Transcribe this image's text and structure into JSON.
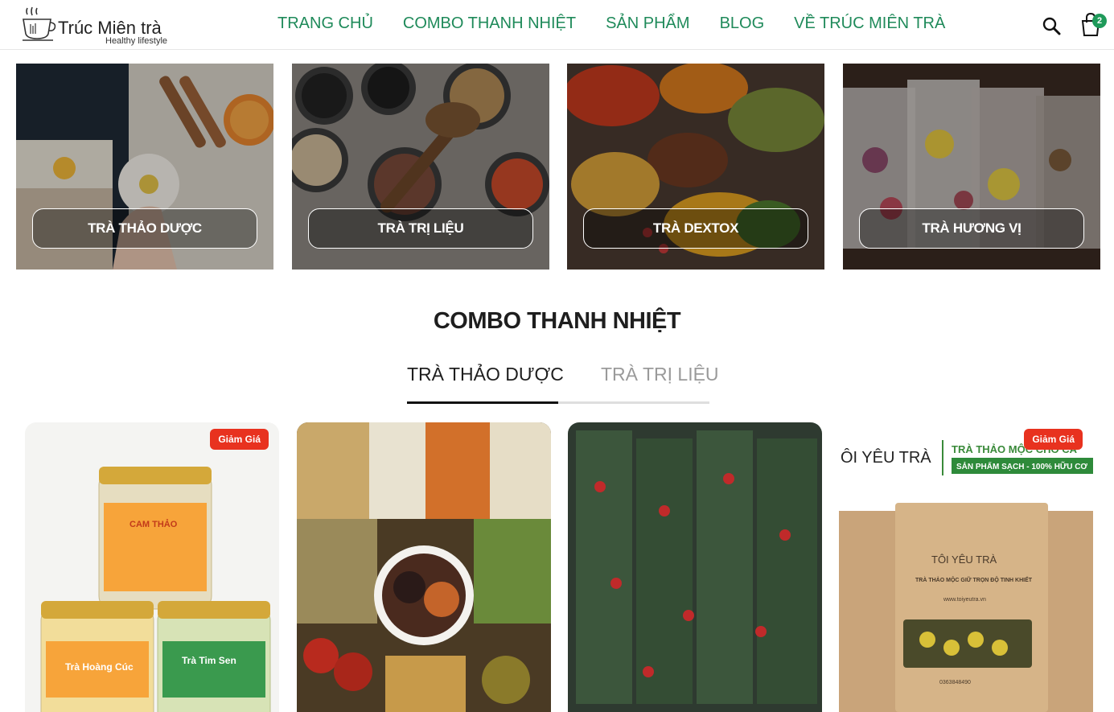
{
  "header": {
    "logo_name": "Trúc Miên trà",
    "logo_tagline": "Healthy lifestyle",
    "nav": [
      "TRANG CHỦ",
      "COMBO THANH NHIỆT",
      "SẢN PHẨM",
      "BLOG",
      "VỀ TRÚC MIÊN TRÀ"
    ],
    "cart_count": "2",
    "accent": "#1f8a5a"
  },
  "categories": [
    {
      "label": "TRÀ THẢO DƯỢC"
    },
    {
      "label": "TRÀ TRỊ LIỆU"
    },
    {
      "label": "TRÀ DEXTOX"
    },
    {
      "label": "TRÀ HƯƠNG VỊ"
    }
  ],
  "section": {
    "title": "COMBO THANH NHIỆT",
    "tabs": [
      "TRÀ THẢO DƯỢC",
      "TRÀ TRỊ LIỆU"
    ]
  },
  "products": [
    {
      "badge": "Giảm Giá",
      "jar_labels": [
        "CAM THẢO",
        "Trà Hoàng Cúc",
        "Trà Tim Sen"
      ]
    },
    {
      "badge": ""
    },
    {
      "badge": ""
    },
    {
      "badge": "Giảm Giá",
      "brand": "ÔI YÊU TRÀ",
      "headline": "TRÀ THẢO MỘC CHO CÁ",
      "subhead": "SẢN PHẨM SẠCH - 100% HỮU CƠ",
      "bag_brand": "TÔI YÊU TRÀ",
      "bag_text": "TRÀ THẢO MỘC GIỮ TRỌN ĐỘ TINH KHIẾT",
      "bag_url": "www.toiyeutra.vn",
      "bag_phone": "0363848490"
    }
  ]
}
